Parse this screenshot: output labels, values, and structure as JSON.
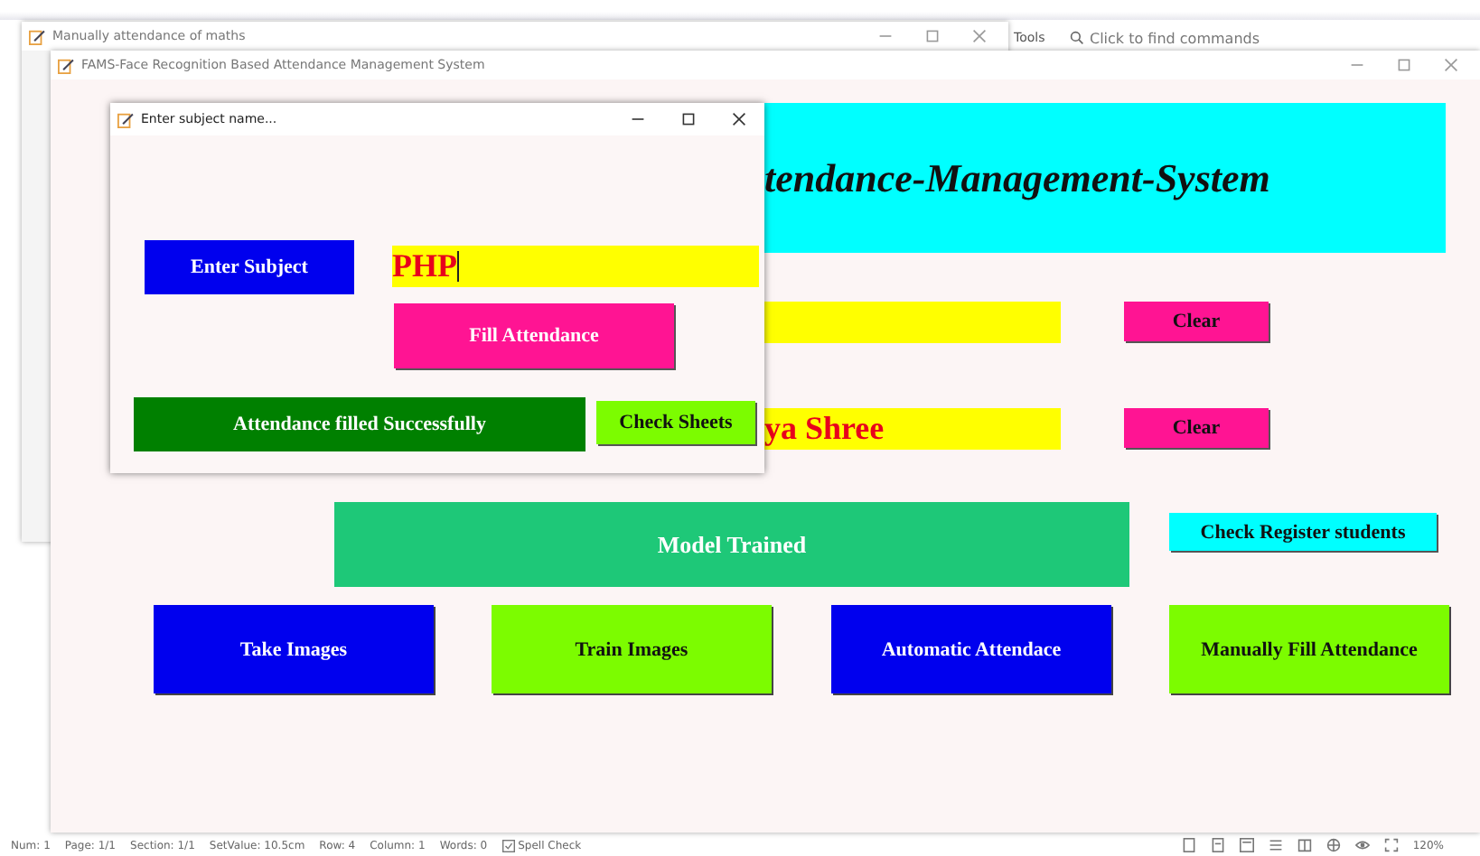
{
  "background_app": {
    "menu_item": "Tools",
    "command_search": {
      "placeholder": "Click to find commands"
    },
    "status_bar": [
      "Num: 1",
      "Page: 1/1",
      "Section: 1/1",
      "SetValue: 10.5cm",
      "Row: 4",
      "Column: 1",
      "Words: 0"
    ],
    "spell_check": "Spell Check",
    "zoom": "120%"
  },
  "back_window": {
    "title": "Manually attendance of maths"
  },
  "main_window": {
    "title": "FAMS-Face Recognition Based Attendance Management System",
    "banner": "tendance-Management-System",
    "name_field": {
      "value": "ya Shree"
    },
    "clear_buttons": [
      "Clear",
      "Clear"
    ],
    "status_message": "Model Trained",
    "register_button": "Check Register students",
    "action_buttons": [
      {
        "label": "Take Images",
        "kind": "blue"
      },
      {
        "label": "Train Images",
        "kind": "lime"
      },
      {
        "label": "Automatic Attendace",
        "kind": "blue"
      },
      {
        "label": "Manually Fill Attendance",
        "kind": "lime"
      }
    ]
  },
  "dialog": {
    "title": "Enter subject name...",
    "label": "Enter Subject",
    "subject_field": {
      "value": "PHP"
    },
    "fill_button": "Fill Attendance",
    "message": "Attendance filled Successfully",
    "sheets_button": "Check Sheets"
  }
}
